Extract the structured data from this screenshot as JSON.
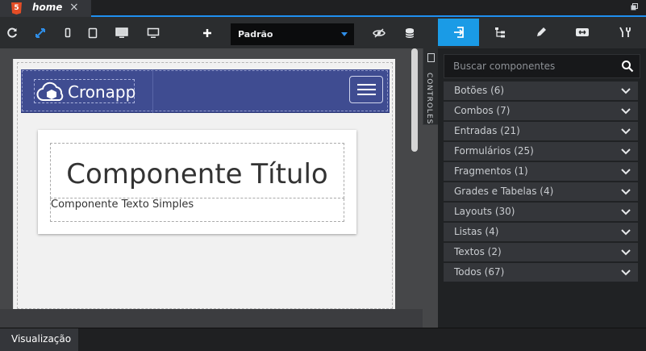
{
  "tab": {
    "icon_text": "5",
    "title": "home",
    "close": "×"
  },
  "toolbar": {
    "icons": [
      "refresh-icon",
      "fit-screen-icon",
      "phone-icon",
      "tablet-icon",
      "desktop-icon",
      "monitor-icon",
      "plus-icon",
      "eye-slash-icon",
      "database-icon"
    ],
    "theme_value": "Padrão"
  },
  "canvas": {
    "logo_text": "Cronapp",
    "card_title": "Componente Título",
    "card_text": "Componente Texto Simples",
    "brand_color": "#3f4c91"
  },
  "controls_tab": {
    "label": "CONTROLES"
  },
  "bottom_bar": {
    "preview_label": "Visualização",
    "grip": "....."
  },
  "panel": {
    "tabs": [
      "components-icon",
      "tree-icon",
      "pencil-icon",
      "swap-icon",
      "wrench-icon"
    ],
    "active_tab_color": "#1a9be6",
    "search_placeholder": "Buscar componentes",
    "categories": [
      {
        "label": "Botões (6)"
      },
      {
        "label": "Combos (7)"
      },
      {
        "label": "Entradas (21)"
      },
      {
        "label": "Formulários (25)"
      },
      {
        "label": "Fragmentos (1)"
      },
      {
        "label": "Grades e Tabelas (4)"
      },
      {
        "label": "Layouts (30)"
      },
      {
        "label": "Listas (4)"
      },
      {
        "label": "Textos (2)"
      },
      {
        "label": "Todos (67)"
      }
    ]
  }
}
